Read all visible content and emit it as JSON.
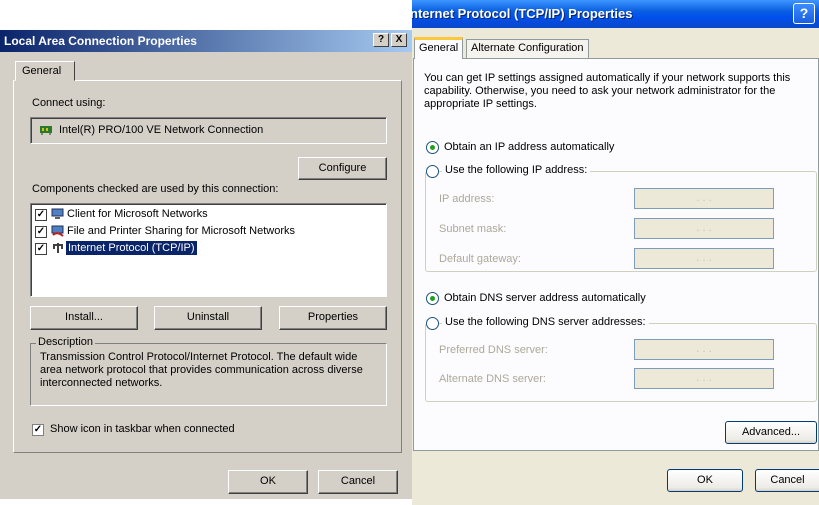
{
  "left_dialog": {
    "title": "Local Area Connection Properties",
    "help_btn": "?",
    "close_btn": "X",
    "tab_general": "General",
    "connect_using_label": "Connect using:",
    "adapter_name": "Intel(R) PRO/100 VE Network Connection",
    "configure_btn": "Configure",
    "components_label": "Components checked are used by this connection:",
    "components": [
      {
        "label": "Client for Microsoft Networks",
        "checked": true,
        "icon": "network-client-icon"
      },
      {
        "label": "File and Printer Sharing for Microsoft Networks",
        "checked": true,
        "icon": "file-printer-sharing-icon"
      },
      {
        "label": "Internet Protocol (TCP/IP)",
        "checked": true,
        "icon": "protocol-icon",
        "selected": true
      }
    ],
    "install_btn": "Install...",
    "uninstall_btn": "Uninstall",
    "properties_btn": "Properties",
    "description_label": "Description",
    "description_text": "Transmission Control Protocol/Internet Protocol. The default wide area network protocol that provides communication across diverse interconnected networks.",
    "show_icon_label": "Show icon in taskbar when connected",
    "show_icon_checked": true,
    "ok_btn": "OK",
    "cancel_btn": "Cancel"
  },
  "right_dialog": {
    "title": "nternet Protocol (TCP/IP) Properties",
    "help_btn": "?",
    "tab_general": "General",
    "tab_alternate": "Alternate Configuration",
    "intro_text": "You can get IP settings assigned automatically if your network supports this capability. Otherwise, you need to ask your network administrator for the appropriate IP settings.",
    "obtain_ip_auto": "Obtain an IP address automatically",
    "use_following_ip": "Use the following IP address:",
    "ip_address_label": "IP address:",
    "subnet_mask_label": "Subnet mask:",
    "default_gateway_label": "Default gateway:",
    "ip_placeholder": ".      .      .",
    "obtain_dns_auto": "Obtain DNS server address automatically",
    "use_following_dns": "Use the following DNS server addresses:",
    "preferred_dns_label": "Preferred DNS server:",
    "alternate_dns_label": "Alternate DNS server:",
    "advanced_btn": "Advanced...",
    "ok_btn": "OK",
    "cancel_btn": "Cancel"
  },
  "colors": {
    "classic_face": "#d4d0c8",
    "classic_title": "#0a246a",
    "xp_face": "#ece9d8",
    "xp_title": "#0050ee",
    "selection": "#0a246a",
    "radio_dot": "#21a121"
  }
}
